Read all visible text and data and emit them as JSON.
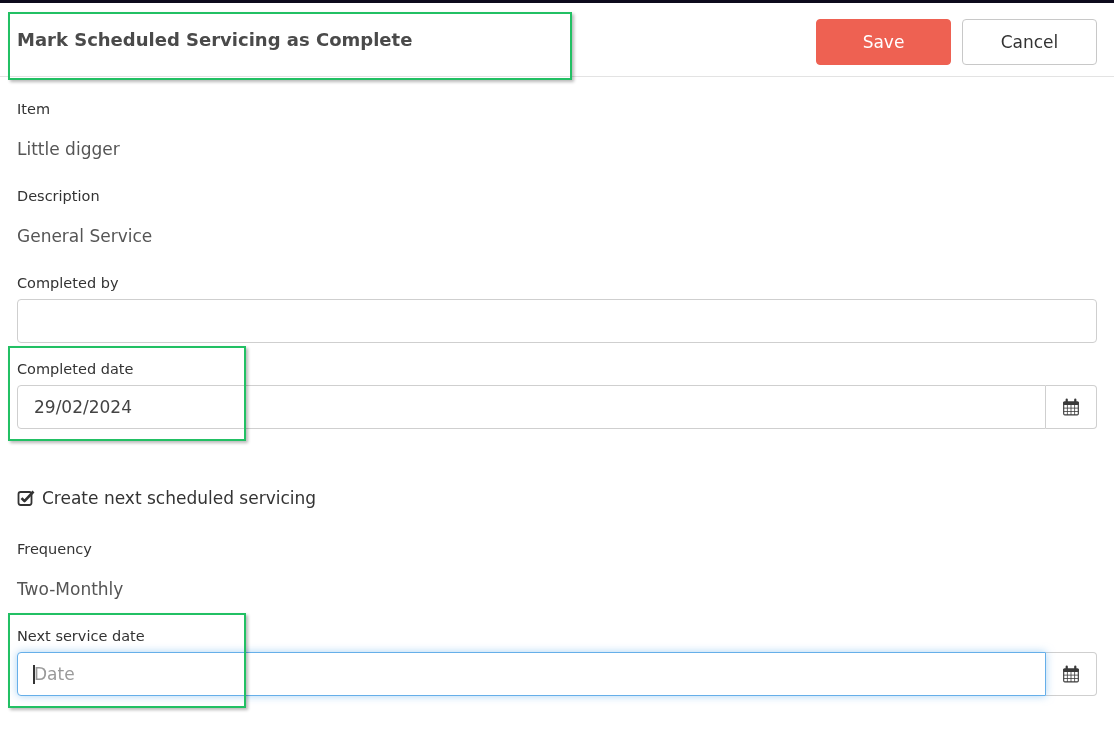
{
  "header": {
    "title": {
      "text": "Mark Scheduled Servicing as Complete",
      "highlighted": true
    },
    "buttons": [
      {
        "label": "Save",
        "kind": "primary"
      },
      {
        "label": "Cancel",
        "kind": "secondary"
      }
    ]
  },
  "fields": [
    {
      "kind": "readonly",
      "label": "Item",
      "value": "Little digger",
      "highlighted": false
    },
    {
      "kind": "readonly",
      "label": "Description",
      "value": "General Service",
      "highlighted": false
    },
    {
      "kind": "text",
      "label": "Completed by",
      "highlighted": false,
      "focused": false
    },
    {
      "kind": "date",
      "label": "Completed date",
      "value": "29/02/2024",
      "highlighted": true,
      "focused": false
    },
    {
      "kind": "checkbox",
      "label": "Create next scheduled servicing",
      "checked": true,
      "highlighted": false
    },
    {
      "kind": "readonly",
      "label": "Frequency",
      "value": "Two-Monthly",
      "highlighted": false
    },
    {
      "kind": "date",
      "label": "Next service date",
      "placeholder": "Date",
      "highlighted": true,
      "focused": true
    }
  ]
}
